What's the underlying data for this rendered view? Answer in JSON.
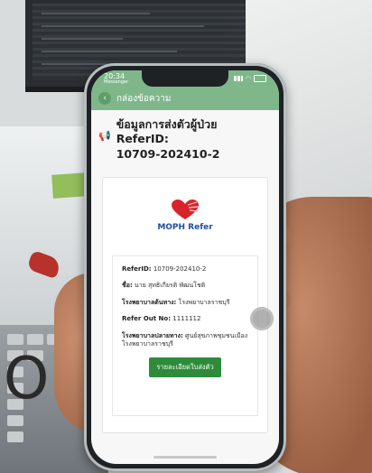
{
  "status_bar": {
    "time": "20:34",
    "carrier": "Messenger"
  },
  "app_bar": {
    "title": "กล่องข้อความ",
    "back_icon": "back-arrow-icon"
  },
  "message": {
    "icon": "speaker-icon",
    "title_line1": "ข้อมูลการส่งตัวผู้ป่วย ReferID:",
    "title_line2": "10709-202410-2"
  },
  "card": {
    "logo_text": "MOPH Refer",
    "fields": [
      {
        "label": "ReferID:",
        "value": "10709-202410-2"
      },
      {
        "label": "ชื่อ:",
        "value": "นาย สุทธิเกียรติ พัฒนโชติ"
      },
      {
        "label": "โรงพยาบาลต้นทาง:",
        "value": "โรงพยาบาลราชบุรี"
      },
      {
        "label": "Refer Out No:",
        "value": "1111112"
      },
      {
        "label": "โรงพยาบาลปลายทาง:",
        "value": "ศูนย์สุขภาพชุมชนเมือง โรงพยาบาลราชบุรี"
      }
    ],
    "button_label": "รายละเอียดใบส่งตัว"
  },
  "overlay_text": "O",
  "colors": {
    "header_green": "#7fb78a",
    "button_green": "#2e8b3a",
    "logo_red": "#d8232a",
    "logo_blue": "#1f4fa0"
  }
}
